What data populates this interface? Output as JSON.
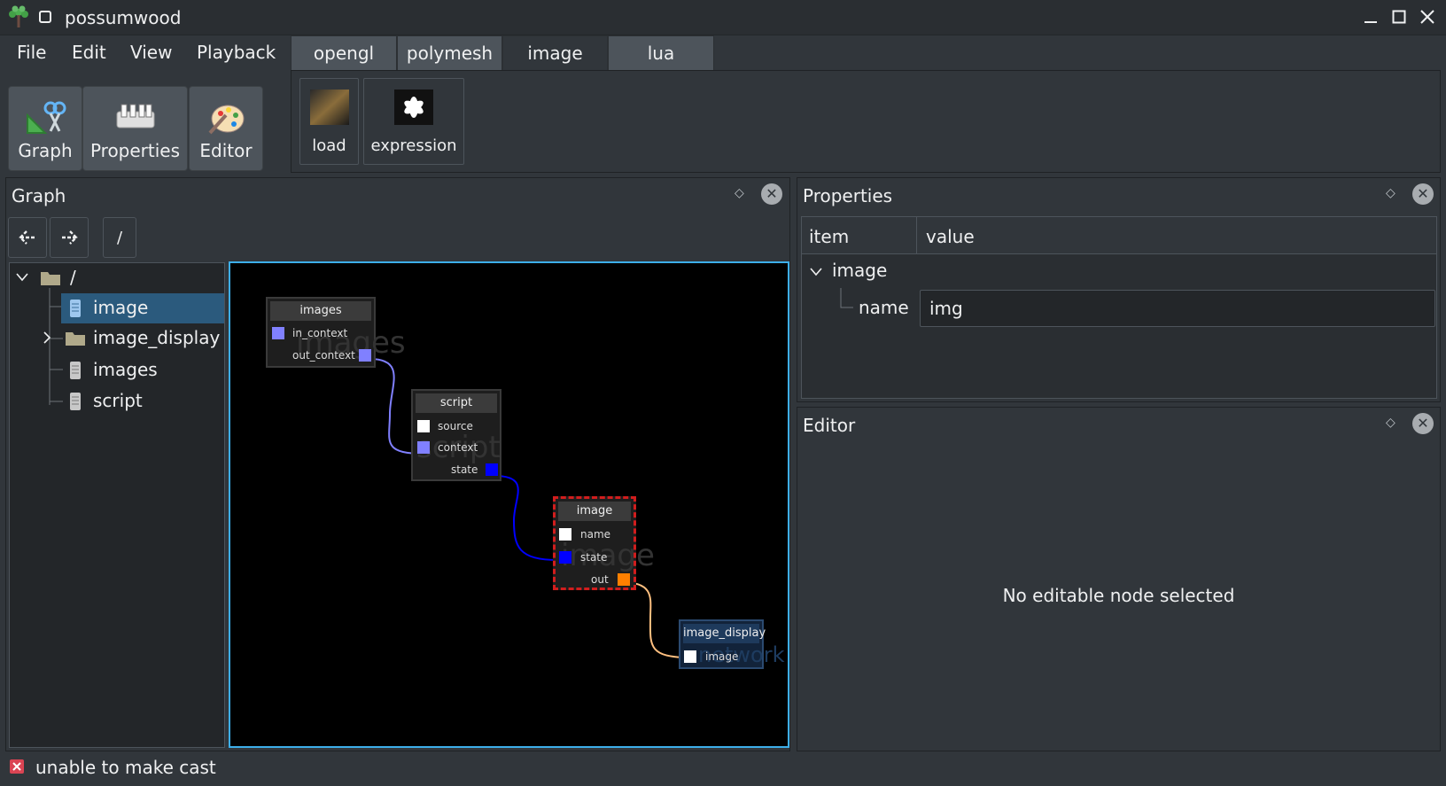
{
  "window": {
    "title": "possumwood",
    "logo_icon": "tree-icon",
    "controls": {
      "minimize": "_",
      "maximize": "□",
      "close": "✕"
    }
  },
  "menu": [
    "File",
    "Edit",
    "View",
    "Playback"
  ],
  "toolbar": {
    "buttons": [
      {
        "label": "Graph",
        "icon": "graph-tool-icon"
      },
      {
        "label": "Properties",
        "icon": "properties-tool-icon"
      },
      {
        "label": "Editor",
        "icon": "editor-palette-icon"
      }
    ]
  },
  "tabs": {
    "items": [
      "opengl",
      "polymesh",
      "image",
      "lua"
    ],
    "active": "image"
  },
  "tab_content": {
    "buttons": [
      {
        "label": "load",
        "icon": "load-image-icon"
      },
      {
        "label": "expression",
        "icon": "expression-icon"
      }
    ]
  },
  "graph_panel": {
    "title": "Graph",
    "nav": {
      "back": "back-icon",
      "forward": "forward-icon",
      "path": "/"
    },
    "tree": {
      "root": "/",
      "children": [
        {
          "label": "image",
          "type": "node",
          "selected": true
        },
        {
          "label": "image_display",
          "type": "network",
          "expandable": true
        },
        {
          "label": "images",
          "type": "node"
        },
        {
          "label": "script",
          "type": "node"
        }
      ]
    },
    "graph": {
      "nodes": {
        "images": {
          "title": "images",
          "watermark": "images",
          "ports": [
            "in_context",
            "out_context"
          ]
        },
        "script": {
          "title": "script",
          "watermark": "script",
          "ports": [
            "source",
            "context",
            "state"
          ]
        },
        "image": {
          "title": "image",
          "watermark": "image",
          "ports": [
            "name",
            "state",
            "out"
          ]
        },
        "image_display": {
          "title": "image_display",
          "watermark": "network",
          "ports": [
            "image"
          ]
        }
      },
      "colors": {
        "context_port": "#8080ff",
        "state_port": "#0000ff",
        "image_port": "#ff8000",
        "plain_port": "#ffffff",
        "selection": "#d11d1d"
      }
    }
  },
  "properties_panel": {
    "title": "Properties",
    "columns": [
      "item",
      "value"
    ],
    "group": "image",
    "rows": [
      {
        "item": "name",
        "value": "img"
      }
    ]
  },
  "editor_panel": {
    "title": "Editor",
    "message": "No editable node selected"
  },
  "status": {
    "text": "unable to make cast",
    "icon": "error-icon"
  }
}
